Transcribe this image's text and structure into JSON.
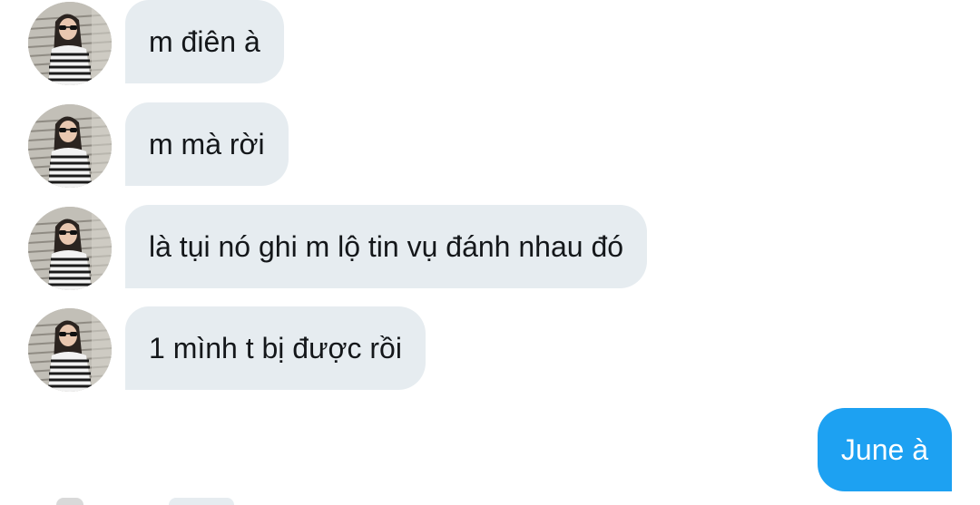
{
  "conversation": {
    "incoming": [
      {
        "text": "m điên à",
        "avatar_icon": "profile-photo-icon"
      },
      {
        "text": "m mà rời",
        "avatar_icon": "profile-photo-icon"
      },
      {
        "text": "là tụi nó ghi m lộ tin vụ đánh nhau đó",
        "avatar_icon": "profile-photo-icon"
      },
      {
        "text": "1 mình t bị được rồi",
        "avatar_icon": "profile-photo-icon"
      }
    ],
    "outgoing": [
      {
        "text": "June à"
      }
    ]
  },
  "colors": {
    "incoming_bubble": "#e6ecf0",
    "outgoing_bubble": "#1da1f2",
    "incoming_text": "#14171a",
    "outgoing_text": "#ffffff"
  }
}
